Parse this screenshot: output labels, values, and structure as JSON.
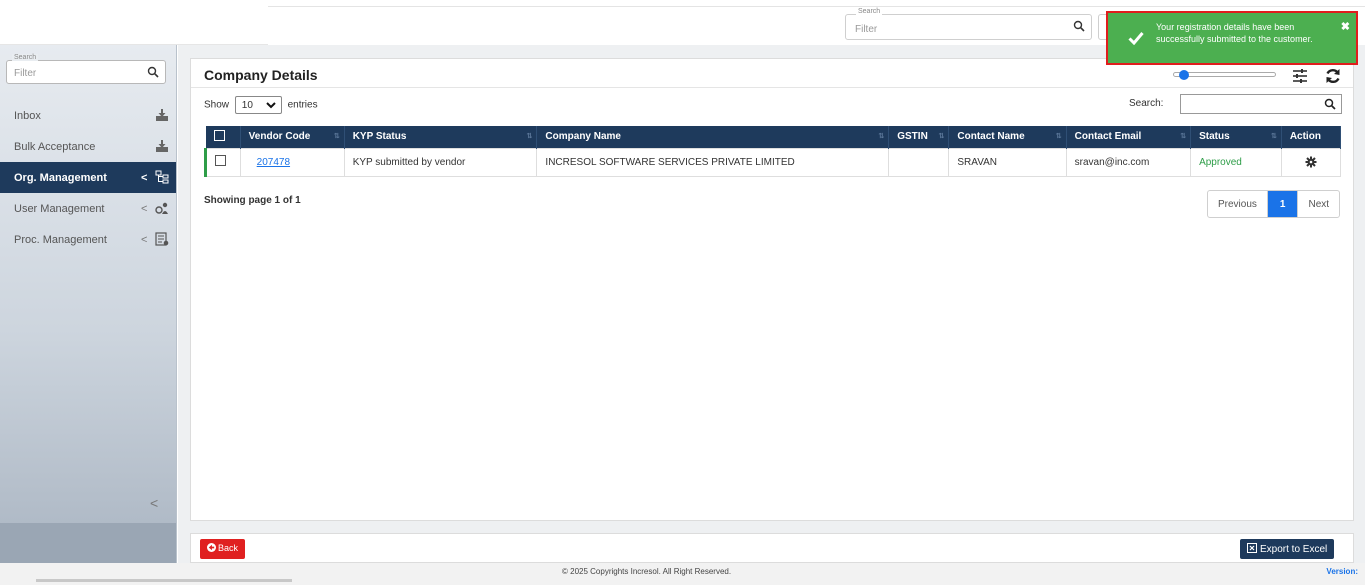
{
  "topbar": {
    "search_label": "Search",
    "search_placeholder": "Filter"
  },
  "sidebar": {
    "search_label": "Search",
    "search_placeholder": "Filter",
    "items": [
      {
        "label": "Inbox",
        "icon": "inbox-download-icon",
        "active": false,
        "has_caret": false
      },
      {
        "label": "Bulk Acceptance",
        "icon": "inbox-download-icon",
        "active": false,
        "has_caret": false
      },
      {
        "label": "Org. Management",
        "icon": "org-chart-icon",
        "active": true,
        "has_caret": true
      },
      {
        "label": "User Management",
        "icon": "users-cog-icon",
        "active": false,
        "has_caret": true
      },
      {
        "label": "Proc. Management",
        "icon": "process-document-icon",
        "active": false,
        "has_caret": true
      }
    ],
    "caret": "<",
    "collapse": "<"
  },
  "panel": {
    "title": "Company Details",
    "show_label": "Show",
    "entries_value": "10",
    "entries_label": "entries",
    "search_label": "Search:",
    "columns": [
      "Vendor Code",
      "KYP Status",
      "Company Name",
      "GSTIN",
      "Contact Name",
      "Contact Email",
      "Status",
      "Action"
    ],
    "rows": [
      {
        "vendor_code": "207478",
        "kyp_status": "KYP submitted by vendor",
        "company_name": "INCRESOL SOFTWARE SERVICES PRIVATE LIMITED",
        "gstin": "",
        "contact_name": "SRAVAN",
        "contact_email": "sravan@inc.com",
        "status": "Approved"
      }
    ],
    "showing": "Showing page 1 of 1",
    "pager": {
      "previous": "Previous",
      "current": "1",
      "next": "Next"
    }
  },
  "bottom": {
    "back_label": "Back",
    "export_label": "Export to Excel"
  },
  "footer": {
    "copyright": "© 2025 Copyrights Incresol. All Right Reserved.",
    "version": "Version:"
  },
  "toast": {
    "message": "Your registration details have been successfully submitted to the customer.",
    "close": "✖"
  },
  "colors": {
    "primary_dark": "#1e3a5c",
    "accent_blue": "#1a73e8",
    "success_green": "#4caf50",
    "approved_text": "#2e9d48",
    "danger_red": "#e02020"
  }
}
